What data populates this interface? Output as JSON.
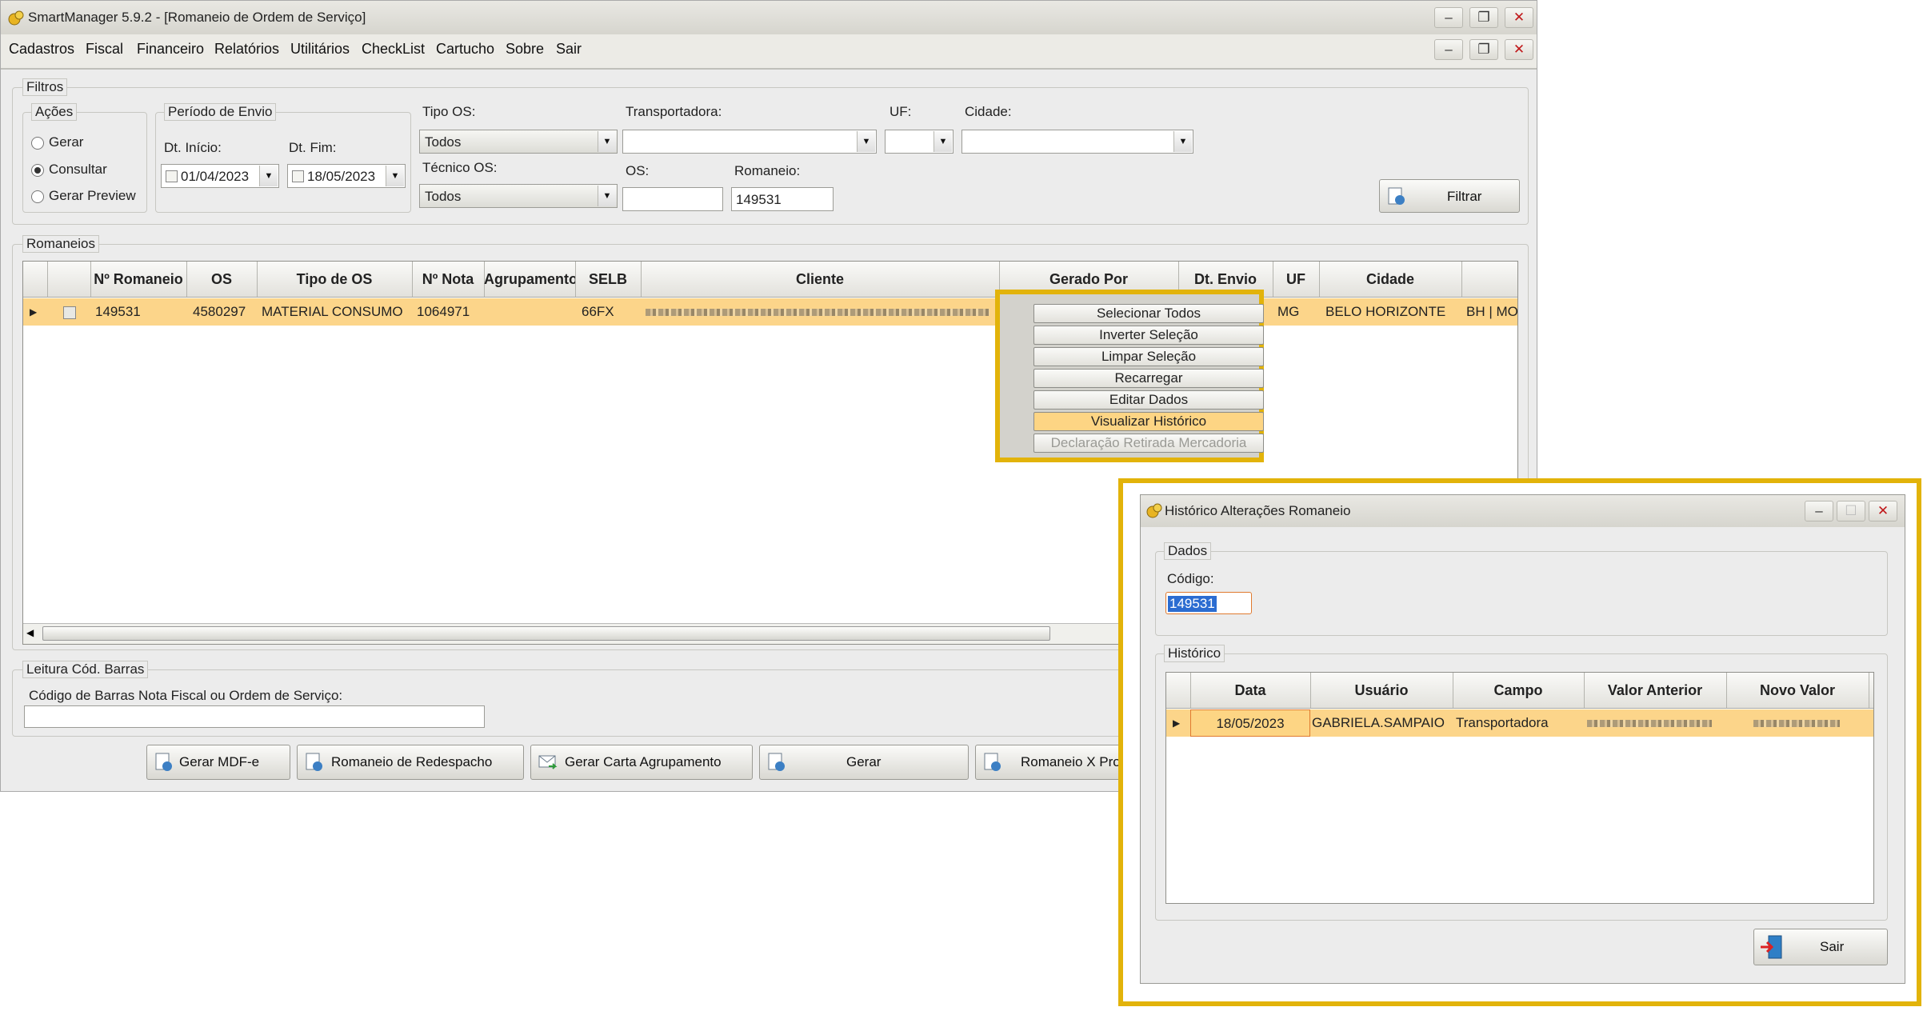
{
  "main": {
    "title": "SmartManager 5.9.2 - [Romaneio de Ordem de Serviço]",
    "menu": [
      "Cadastros",
      "Fiscal",
      "Financeiro",
      "Relatórios",
      "Utilitários",
      "CheckList",
      "Cartucho",
      "Sobre",
      "Sair"
    ]
  },
  "filtros": {
    "legend": "Filtros",
    "acoes": {
      "legend": "Ações",
      "options": [
        "Gerar",
        "Consultar",
        "Gerar Preview"
      ],
      "selected": "Consultar"
    },
    "periodo": {
      "legend": "Período de Envio",
      "inicio_label": "Dt. Início:",
      "inicio_value": "01/04/2023",
      "fim_label": "Dt. Fim:",
      "fim_value": "18/05/2023"
    },
    "tipo_os": {
      "label": "Tipo OS:",
      "value": "Todos"
    },
    "tecnico_os": {
      "label": "Técnico OS:",
      "value": "Todos"
    },
    "transportadora": {
      "label": "Transportadora:",
      "value": ""
    },
    "uf": {
      "label": "UF:",
      "value": ""
    },
    "cidade": {
      "label": "Cidade:",
      "value": ""
    },
    "os": {
      "label": "OS:",
      "value": ""
    },
    "romaneio": {
      "label": "Romaneio:",
      "value": "149531"
    },
    "filtrar_label": "Filtrar"
  },
  "romaneios": {
    "legend": "Romaneios",
    "columns": [
      "Nº Romaneio",
      "OS",
      "Tipo de OS",
      "Nº Nota",
      "Agrupamento",
      "SELB",
      "Cliente",
      "Gerado Por",
      "Dt. Envio",
      "UF",
      "Cidade"
    ],
    "row": {
      "romaneio": "149531",
      "os": "4580297",
      "tipo": "MATERIAL CONSUMO",
      "nota": "1064971",
      "agrupamento": "",
      "selb": "66FX",
      "uf": "MG",
      "cidade": "BELO HORIZONTE",
      "extra": "BH | MO"
    }
  },
  "context_menu": {
    "items": [
      "Selecionar Todos",
      "Inverter Seleção",
      "Limpar Seleção",
      "Recarregar",
      "Editar Dados",
      "Visualizar Histórico",
      "Declaração Retirada Mercadoria"
    ],
    "highlighted": "Visualizar Histórico",
    "disabled": "Declaração Retirada Mercadoria"
  },
  "leitura": {
    "legend": "Leitura Cód. Barras",
    "label": "Código de Barras Nota Fiscal ou Ordem de Serviço:",
    "value": ""
  },
  "bottom_buttons": [
    "Gerar MDF-e",
    "Romaneio de Redespacho",
    "Gerar Carta Agrupamento",
    "Gerar",
    "Romaneio X Produto"
  ],
  "dialog": {
    "title": "Histórico Alterações Romaneio",
    "dados_legend": "Dados",
    "codigo_label": "Código:",
    "codigo_value": "149531",
    "historico_legend": "Histórico",
    "columns": [
      "Data",
      "Usuário",
      "Campo",
      "Valor Anterior",
      "Novo Valor"
    ],
    "row": {
      "data": "18/05/2023",
      "usuario": "GABRIELA.SAMPAIO",
      "campo": "Transportadora"
    },
    "sair_label": "Sair"
  }
}
